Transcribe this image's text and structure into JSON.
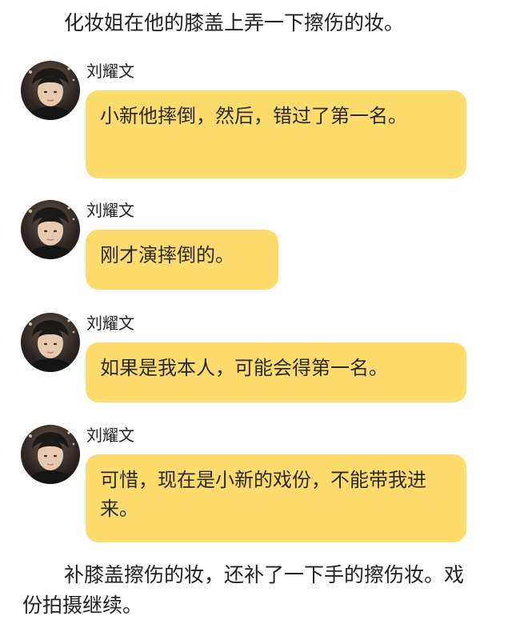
{
  "narration": {
    "top": "化妆姐在他的膝盖上弄一下擦伤的妆。",
    "bottom": "补膝盖擦伤的妆，还补了一下手的擦伤妆。戏份拍摄继续。"
  },
  "messages": [
    {
      "sender": "刘耀文",
      "text": "小新他摔倒，然后，错过了第一名。"
    },
    {
      "sender": "刘耀文",
      "text": "刚才演摔倒的。"
    },
    {
      "sender": "刘耀文",
      "text": "如果是我本人，可能会得第一名。"
    },
    {
      "sender": "刘耀文",
      "text": "可惜，现在是小新的戏份，不能带我进来。"
    }
  ],
  "colors": {
    "bubble": "#fddb6c",
    "background": "#ffffff"
  }
}
